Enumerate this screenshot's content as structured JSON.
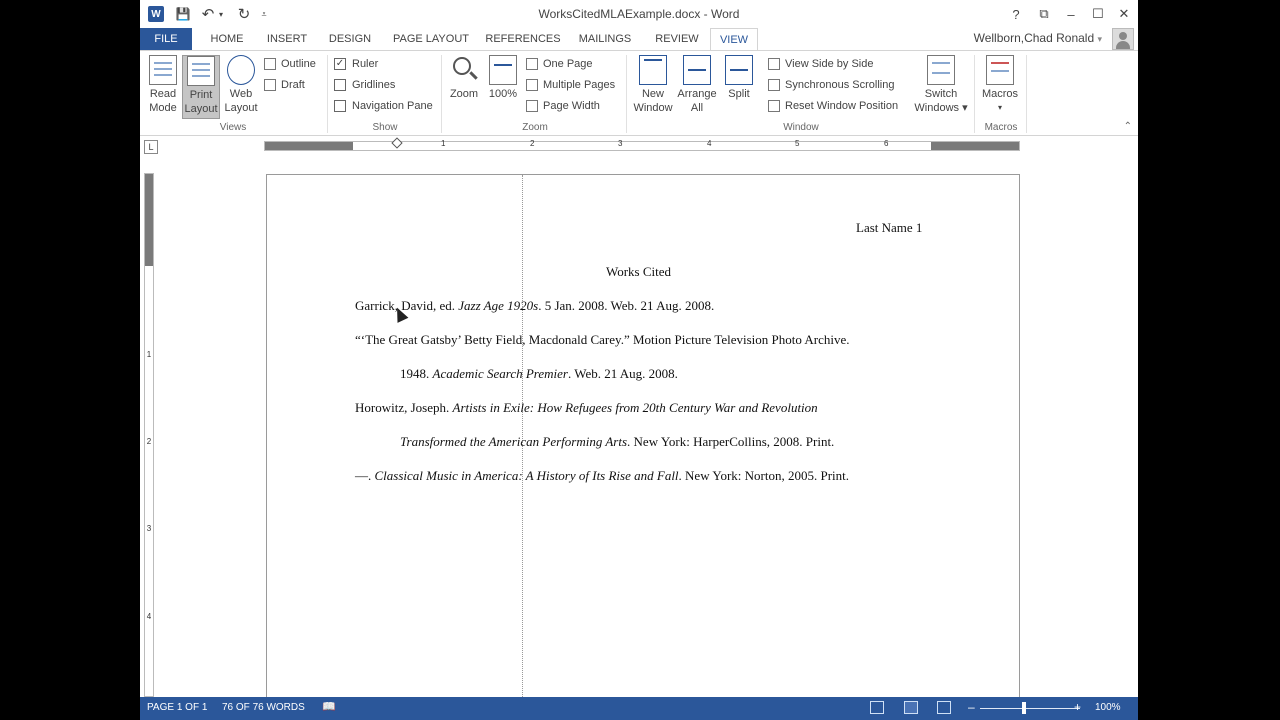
{
  "window": {
    "title": "WorksCitedMLAExample.docx - Word",
    "controls": {
      "help": "?",
      "ribbon_options": "⧉",
      "minimize": "–",
      "restore": "☐",
      "close": "✕"
    }
  },
  "qat": {
    "app_icon": "W",
    "save": "💾",
    "undo": "↶",
    "undo_arrow": "▾",
    "redo": "↻",
    "customize": "⩡"
  },
  "tabs": [
    "FILE",
    "HOME",
    "INSERT",
    "DESIGN",
    "PAGE LAYOUT",
    "REFERENCES",
    "MAILINGS",
    "REVIEW",
    "VIEW"
  ],
  "active_tab": "VIEW",
  "user": {
    "name": "Wellborn,Chad Ronald",
    "arrow": "▾"
  },
  "ribbon": {
    "views": {
      "label": "Views",
      "read_mode_1": "Read",
      "read_mode_2": "Mode",
      "print_layout_1": "Print",
      "print_layout_2": "Layout",
      "web_layout_1": "Web",
      "web_layout_2": "Layout",
      "outline": "Outline",
      "draft": "Draft"
    },
    "show": {
      "label": "Show",
      "ruler": "Ruler",
      "ruler_checked": "✓",
      "gridlines": "Gridlines",
      "navigation_pane": "Navigation Pane"
    },
    "zoom": {
      "label": "Zoom",
      "zoom": "Zoom",
      "hundred": "100%",
      "one_page": "One Page",
      "multiple_pages": "Multiple Pages",
      "page_width": "Page Width"
    },
    "window": {
      "label": "Window",
      "new_window_1": "New",
      "new_window_2": "Window",
      "arrange_all_1": "Arrange",
      "arrange_all_2": "All",
      "split": "Split",
      "view_side_by_side": "View Side by Side",
      "synchronous_scrolling": "Synchronous Scrolling",
      "reset_window_position": "Reset Window Position",
      "switch_windows_1": "Switch",
      "switch_windows_2": "Windows ▾"
    },
    "macros": {
      "label": "Macros",
      "macros": "Macros",
      "arrow": "▾"
    },
    "collapse": "⌃"
  },
  "ruler": {
    "corner": "L",
    "numbers": [
      "1",
      "2",
      "3",
      "4",
      "5",
      "6"
    ],
    "vnumbers": [
      "1",
      "2",
      "3",
      "4"
    ]
  },
  "document": {
    "header": "Last Name 1",
    "title": "Works Cited",
    "entries": [
      {
        "plain1": "Garrick, David, ed. ",
        "italic": "Jazz Age 1920s",
        "plain2": ". 5 Jan. 2008. Web. 21 Aug. 2008."
      },
      {
        "plain1": "“‘The Great Gatsby’ Betty Field, Macdonald Carey.” Motion Picture Television Photo Archive.",
        "italic": "",
        "plain2": ""
      },
      {
        "plain1": "1948. ",
        "italic": "Academic Search Premier",
        "plain2": ". Web. 21 Aug. 2008."
      },
      {
        "plain1": "Horowitz, Joseph. ",
        "italic": "Artists in Exile: How Refugees from 20th Century War and Revolution",
        "plain2": ""
      },
      {
        "plain1": "",
        "italic": "Transformed the American Performing Arts",
        "plain2": ". New York: HarperCollins, 2008. Print."
      },
      {
        "plain1": "—. ",
        "italic": "Classical Music in America: A History of Its Rise and Fall",
        "plain2": ". New York: Norton, 2005. Print."
      }
    ]
  },
  "status": {
    "page": "PAGE 1 OF 1",
    "words": "76 OF 76 WORDS",
    "proof_icon": "📖",
    "zoom_minus": "–",
    "zoom_plus": "+",
    "zoom_level": "100%"
  },
  "colors": {
    "accent": "#2b579a",
    "status_bar": "#2b579a"
  }
}
